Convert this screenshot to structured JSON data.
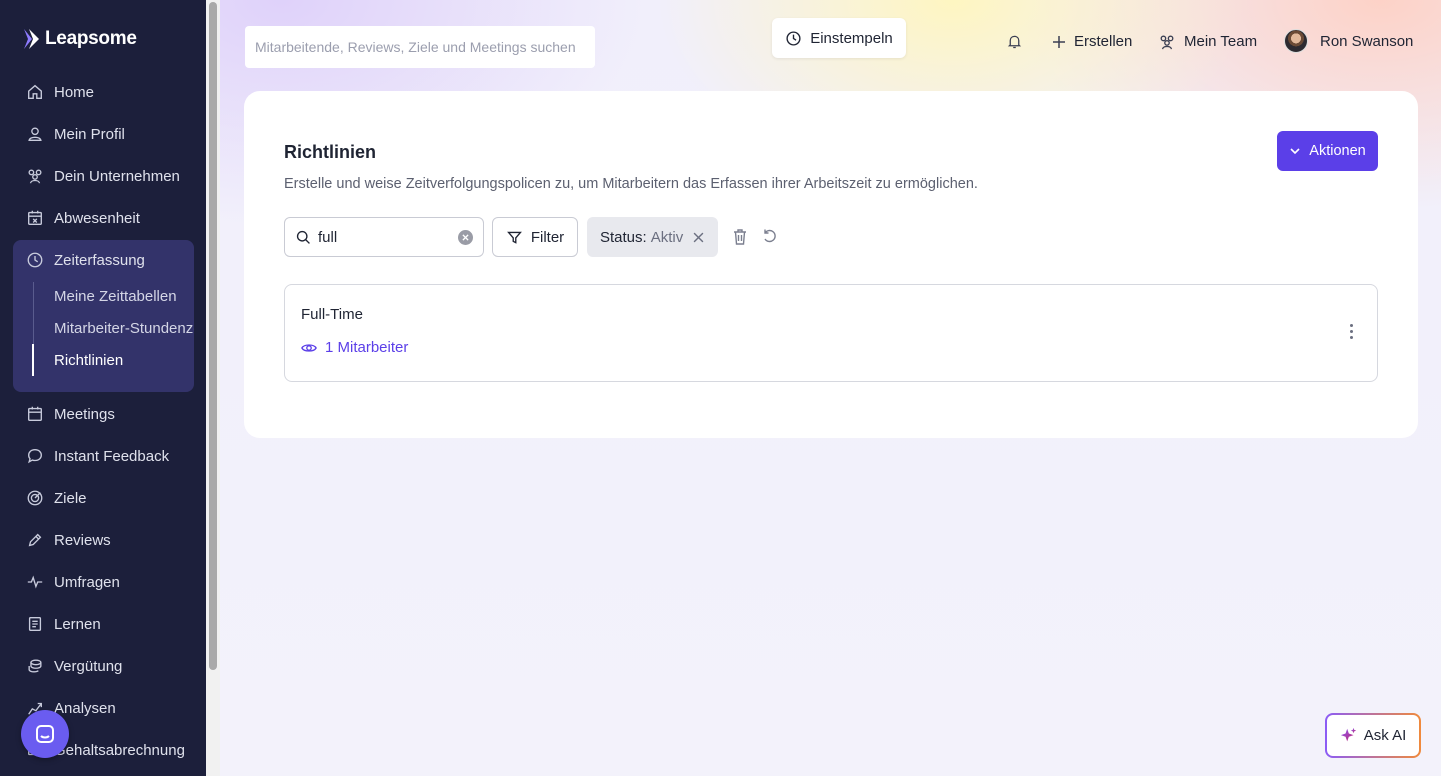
{
  "app": {
    "logo_text": "Leapsome"
  },
  "sidebar": {
    "items": [
      {
        "label": "Home",
        "icon": "home-icon"
      },
      {
        "label": "Mein Profil",
        "icon": "user-icon"
      },
      {
        "label": "Dein Unternehmen",
        "icon": "users-icon"
      },
      {
        "label": "Abwesenheit",
        "icon": "calendar-x-icon"
      },
      {
        "label": "Zeiterfassung",
        "icon": "clock-icon"
      },
      {
        "label": "Meetings",
        "icon": "calendar-icon"
      },
      {
        "label": "Instant Feedback",
        "icon": "chat-icon"
      },
      {
        "label": "Ziele",
        "icon": "target-icon"
      },
      {
        "label": "Reviews",
        "icon": "pen-icon"
      },
      {
        "label": "Umfragen",
        "icon": "pulse-icon"
      },
      {
        "label": "Lernen",
        "icon": "book-icon"
      },
      {
        "label": "Vergütung",
        "icon": "coins-icon"
      },
      {
        "label": "Analysen",
        "icon": "chart-icon"
      },
      {
        "label": "Gehaltsabrechnung",
        "icon": "payroll-icon"
      }
    ],
    "zeiterfassung_sub": [
      {
        "label": "Meine Zeittabellen"
      },
      {
        "label": "Mitarbeiter-Stundenzettel"
      },
      {
        "label": "Richtlinien",
        "active": true
      }
    ]
  },
  "topbar": {
    "search_placeholder": "Mitarbeitende, Reviews, Ziele und Meetings suchen",
    "clock_in_label": "Einstempeln",
    "create_label": "Erstellen",
    "team_label": "Mein Team",
    "user_name": "Ron Swanson"
  },
  "page": {
    "title": "Richtlinien",
    "description": "Erstelle und weise Zeitverfolgungspolicen zu, um Mitarbeitern das Erfassen ihrer Arbeitszeit zu ermöglichen.",
    "actions_label": "Aktionen"
  },
  "filters": {
    "search_value": "full",
    "filter_label": "Filter",
    "status_key": "Status:",
    "status_value": "Aktiv"
  },
  "policies": [
    {
      "name": "Full-Time",
      "employees_label": "1 Mitarbeiter"
    }
  ],
  "ask_ai_label": "Ask AI",
  "colors": {
    "accent": "#5b3fe8",
    "sidebar_bg": "#1c1f3b",
    "sidebar_active": "#33336a"
  }
}
